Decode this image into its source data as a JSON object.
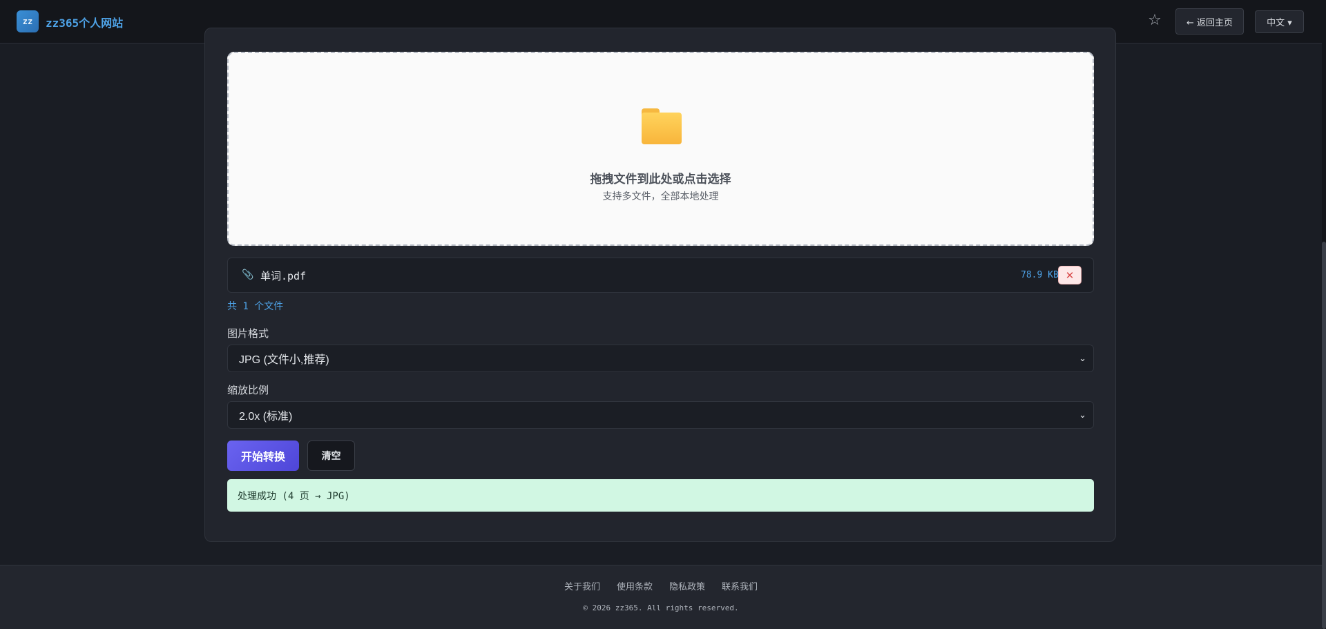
{
  "header": {
    "logo_text": "zz",
    "site_title": "zz365个人网站",
    "star_glyph": "☆",
    "home_label": "← 返回主页",
    "lang_label": "中文 ▾"
  },
  "upload": {
    "drop_title": "拖拽文件到此处或点击选择",
    "drop_subtitle": "支持多文件，全部本地处理"
  },
  "files": [
    {
      "name": "单词.pdf",
      "size": "78.9 KB",
      "remove_glyph": "✕"
    }
  ],
  "file_count": "共 1 个文件",
  "options": {
    "format_label": "图片格式",
    "format_value": "JPG (文件小,推荐)",
    "scale_label": "缩放比例",
    "scale_value": "2.0x (标准)"
  },
  "actions": {
    "start_label": "开始转换",
    "clear_label": "清空"
  },
  "status": {
    "message": "处理成功 (4 页 → JPG)"
  },
  "footer": {
    "links": [
      "关于我们",
      "使用条款",
      "隐私政策",
      "联系我们"
    ],
    "copyright": "© 2026 zz365. All rights reserved."
  },
  "colors": {
    "accent": "#4ea3e8",
    "primary_button": "#5b54e6",
    "success_bg": "#d1f7e3",
    "danger": "#d94c4c"
  }
}
